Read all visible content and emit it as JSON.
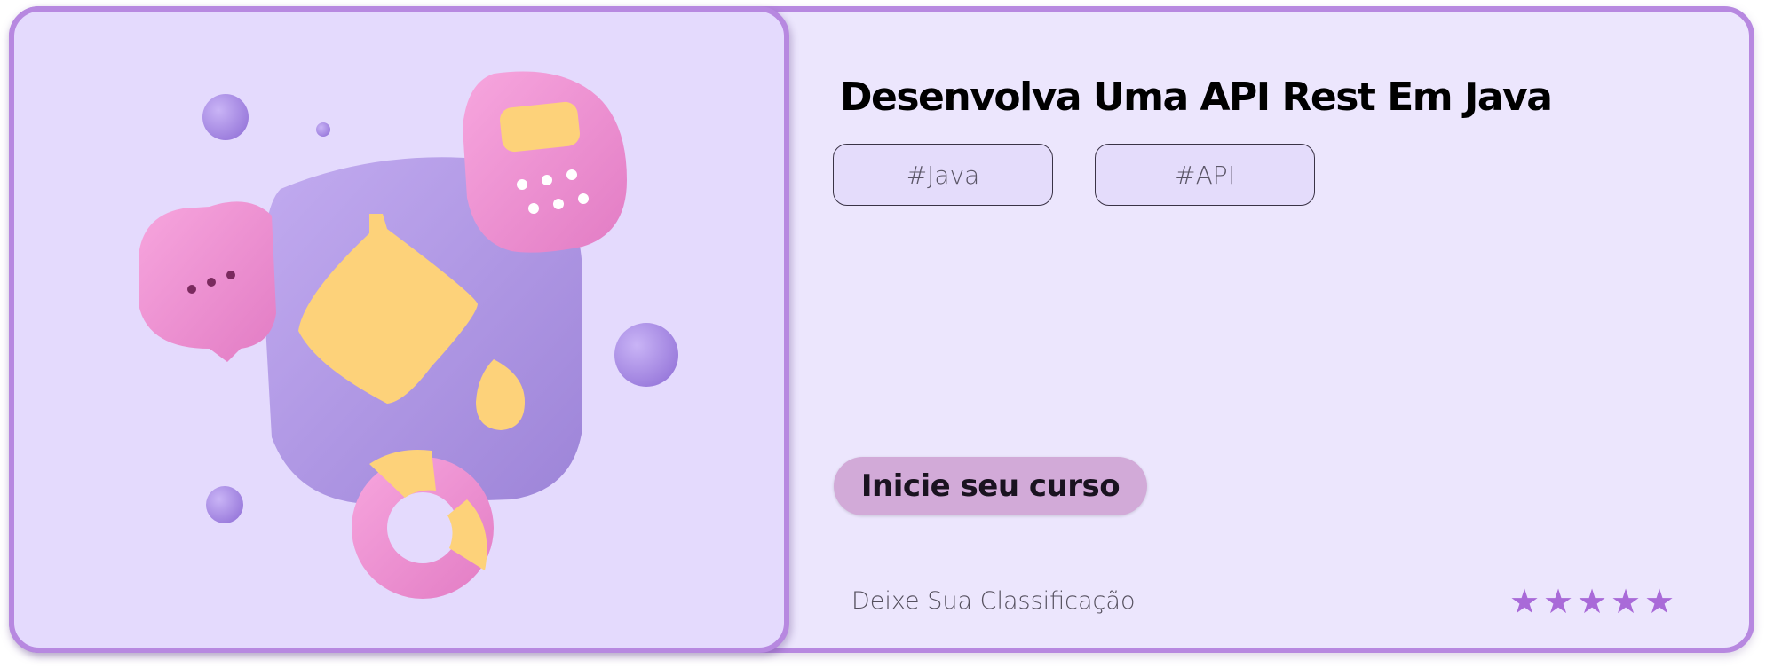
{
  "course": {
    "title": "Desenvolva Uma API Rest Em Java",
    "tags": [
      "#Java",
      "#API"
    ],
    "cta_label": "Inicie seu curso",
    "rating_label": "Deixe Sua Classificação",
    "rating": {
      "max": 5,
      "star_glyph": "★"
    }
  },
  "image": {
    "icon": "3d-chat-calculator-document-illustration"
  },
  "colors": {
    "border": "#b788e0",
    "card_bg": "#ece6fd",
    "image_bg": "#e4dafd",
    "cta_bg": "#d2aad8",
    "star": "#a96ad8"
  }
}
